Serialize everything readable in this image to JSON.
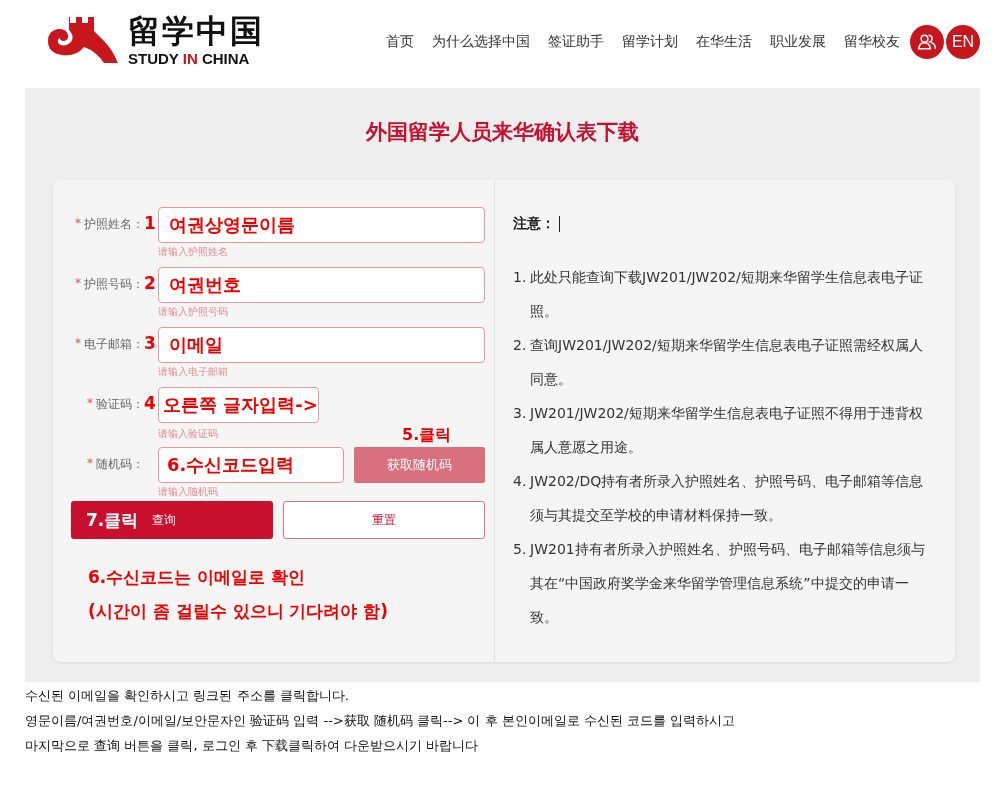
{
  "header": {
    "logo_title": "留学中国",
    "logo_subtitle": [
      "STUDY ",
      "IN",
      " CHINA"
    ],
    "nav": [
      "首页",
      "为什么选择中国",
      "签证助手",
      "留学计划",
      "在华生活",
      "职业发展",
      "留华校友"
    ],
    "language": "EN"
  },
  "page_title": "外国留学人员来华确认表下载",
  "form": {
    "fields": [
      {
        "kind": "text",
        "required_mark": "*",
        "label": "护照姓名：",
        "marker": "1",
        "value": "여권상영문이름",
        "hint": "请输入护照姓名"
      },
      {
        "kind": "text",
        "required_mark": "*",
        "label": "护照号码：",
        "marker": "2",
        "value": "여권번호",
        "hint": "请输入护照号码"
      },
      {
        "kind": "text",
        "required_mark": "*",
        "label": "电子邮箱：",
        "marker": "3",
        "value": "이메일",
        "hint": "请输入电子邮箱"
      },
      {
        "kind": "captcha",
        "required_mark": "*",
        "label": "验证码：",
        "marker": "4",
        "value": "오른쪽 글자입력->",
        "hint": "请输入验证码"
      },
      {
        "kind": "code",
        "required_mark": "*",
        "label": "随机码：",
        "value": "6.수신코드입력",
        "hint": "请输入随机码",
        "button": "获取随机码",
        "button_note": "5.클릭"
      }
    ],
    "actions": [
      {
        "kind": "primary",
        "note": "7.클릭",
        "label": "查询"
      },
      {
        "kind": "secondary",
        "label": "重置"
      }
    ],
    "annotation": [
      "6.수신코드는 이메일로 확인",
      "(시간이 좀 걸릴수 있으니 기다려야 함)"
    ]
  },
  "notice": {
    "title": "注意：",
    "items": [
      {
        "number": "1.",
        "text": "此处只能查询下载JW201/JW202/短期来华留学生信息表电子证照。"
      },
      {
        "number": "2.",
        "text": "查询JW201/JW202/短期来华留学生信息表电子证照需经权属人同意。"
      },
      {
        "number": "3.",
        "text": "JW201/JW202/短期来华留学生信息表电子证照不得用于违背权属人意愿之用途。"
      },
      {
        "number": "4.",
        "text": "JW202/DQ持有者所录入护照姓名、护照号码、电子邮箱等信息须与其提交至学校的申请材料保持一致。"
      },
      {
        "number": "5.",
        "text": "JW201持有者所录入护照姓名、护照号码、电子邮箱等信息须与其在“中国政府奖学金来华留学管理信息系统”中提交的申请一致。"
      }
    ]
  },
  "instructions": [
    "수신된 이메일을 확인하시고 링크된 주소를 클릭합니다.",
    "영문이름/여권번호/이메일/보안문자인 验证码 입력 -->获取 随机码 클릭--> 이 후 본인이메일로 수신된 코드를 입력하시고",
    "마지막으로 查询 버튼을 클릭, 로그인 후 下载클릭하여 다운받으시기 바랍니다"
  ]
}
